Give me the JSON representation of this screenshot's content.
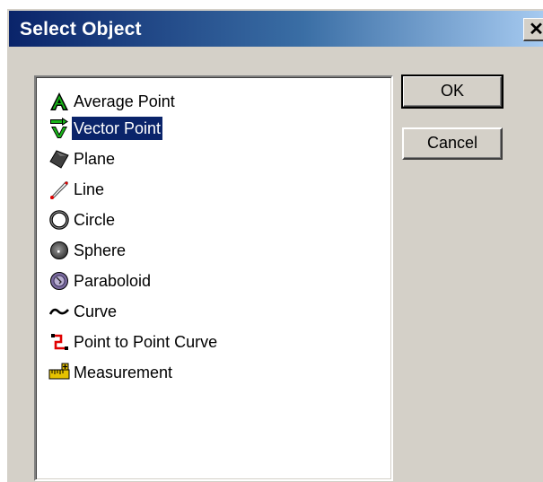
{
  "dialog": {
    "title": "Select Object",
    "close_glyph": "✕"
  },
  "list": {
    "items": [
      {
        "label": "Average Point",
        "icon": "average-point-icon",
        "selected": false
      },
      {
        "label": "Vector Point",
        "icon": "vector-point-icon",
        "selected": true
      },
      {
        "label": "Plane",
        "icon": "plane-icon",
        "selected": false
      },
      {
        "label": "Line",
        "icon": "line-icon",
        "selected": false
      },
      {
        "label": "Circle",
        "icon": "circle-icon",
        "selected": false
      },
      {
        "label": "Sphere",
        "icon": "sphere-icon",
        "selected": false
      },
      {
        "label": "Paraboloid",
        "icon": "paraboloid-icon",
        "selected": false
      },
      {
        "label": "Curve",
        "icon": "curve-icon",
        "selected": false
      },
      {
        "label": "Point to Point Curve",
        "icon": "point-to-point-curve-icon",
        "selected": false
      },
      {
        "label": "Measurement",
        "icon": "measurement-icon",
        "selected": false
      }
    ]
  },
  "buttons": {
    "ok_label": "OK",
    "cancel_label": "Cancel"
  },
  "colors": {
    "title_gradient_start": "#0a246a",
    "title_gradient_end": "#a6caf0",
    "selection": "#0a246a",
    "dialog_face": "#d4d0c8"
  }
}
